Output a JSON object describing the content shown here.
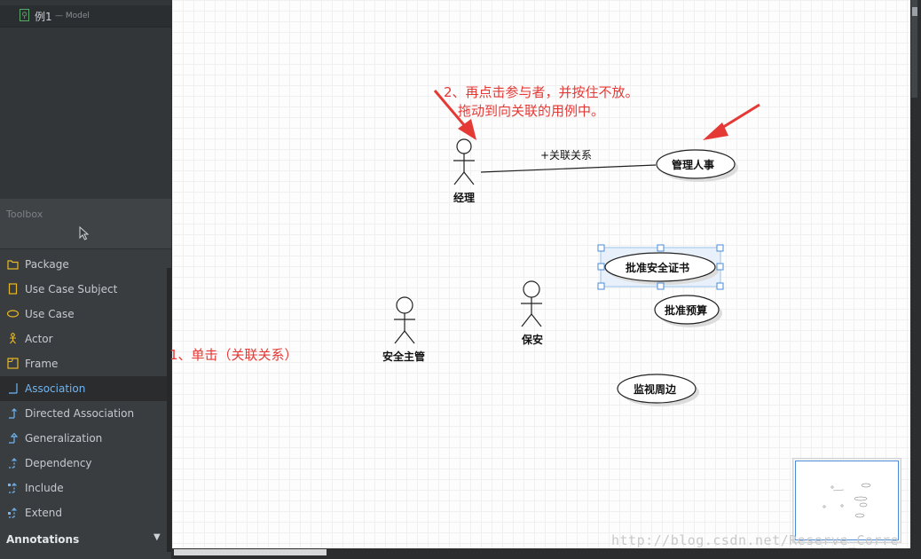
{
  "model": {
    "name": "例1",
    "type": "— Model",
    "icon": "use-case-diagram-icon"
  },
  "toolbox": {
    "title": "Toolbox",
    "items": [
      {
        "label": "Package",
        "icon": "package-icon"
      },
      {
        "label": "Use Case Subject",
        "icon": "use-case-subject-icon"
      },
      {
        "label": "Use Case",
        "icon": "use-case-icon"
      },
      {
        "label": "Actor",
        "icon": "actor-icon"
      },
      {
        "label": "Frame",
        "icon": "frame-icon"
      },
      {
        "label": "Association",
        "icon": "association-icon",
        "selected": true
      },
      {
        "label": "Directed Association",
        "icon": "directed-association-icon"
      },
      {
        "label": "Generalization",
        "icon": "generalization-icon"
      },
      {
        "label": "Dependency",
        "icon": "dependency-icon"
      },
      {
        "label": "Include",
        "icon": "include-icon"
      },
      {
        "label": "Extend",
        "icon": "extend-icon"
      }
    ],
    "section": "Annotations"
  },
  "diagram": {
    "notes": {
      "step2_line1": "2、再点击参与者，并按住不放。",
      "step2_line2": "拖动到向关联的用例中。",
      "step1": "1、单击（关联关系）"
    },
    "association_label": "+关联关系",
    "actors": {
      "manager": "经理",
      "security_chief": "安全主管",
      "guard": "保安"
    },
    "use_cases": {
      "hr": "管理人事",
      "approve_cert": "批准安全证书",
      "approve_budget": "批准预算",
      "monitor": "监视周边"
    }
  },
  "watermark": "http://blog.csdn.net/Reserve_Corre",
  "colors": {
    "accent": "#6fb5f2",
    "annotation_red": "#e53935",
    "selection": "#4a8ad4"
  }
}
